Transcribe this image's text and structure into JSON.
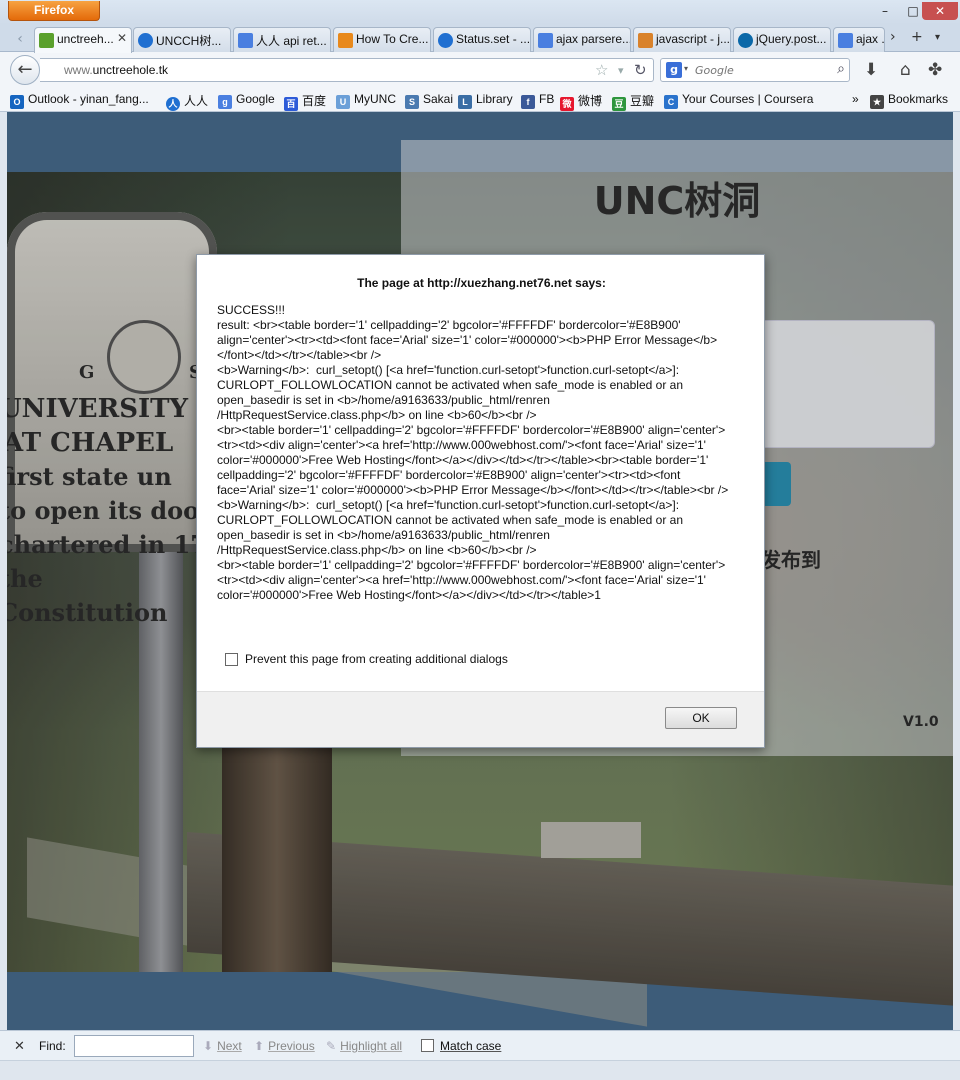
{
  "browser": {
    "app_button": "Firefox",
    "window_controls": {
      "minimize": "–",
      "maximize": "□",
      "close": "✕"
    },
    "tabs": [
      {
        "label": "unctreeh...",
        "active": true,
        "close": "✕"
      },
      {
        "label": "UNCCH树..."
      },
      {
        "label": "人人 api ret..."
      },
      {
        "label": "How To Cre..."
      },
      {
        "label": "Status.set - ..."
      },
      {
        "label": "ajax parsere..."
      },
      {
        "label": "javascript - j..."
      },
      {
        "label": "jQuery.post..."
      },
      {
        "label": "ajax ..."
      }
    ],
    "url_prefix": "www.",
    "url_domain": "unctreehole.tk",
    "search_placeholder": "Google",
    "bookmarks": [
      {
        "label": "Outlook - yinan_fang...",
        "icon_color": "#1565c0",
        "icon_glyph": "O"
      },
      {
        "label": "人人",
        "icon_color": "#1f6fd1",
        "icon_glyph": "人"
      },
      {
        "label": "Google",
        "icon_color": "#4a7fe0",
        "icon_glyph": "g"
      },
      {
        "label": "百度",
        "icon_color": "#2d5bd8",
        "icon_glyph": "百"
      },
      {
        "label": "MyUNC",
        "icon_color": "#6ca0d8",
        "icon_glyph": "U"
      },
      {
        "label": "Sakai",
        "icon_color": "#4a7ab0",
        "icon_glyph": "S"
      },
      {
        "label": "Library",
        "icon_color": "#3b6ea5",
        "icon_glyph": "L"
      },
      {
        "label": "FB",
        "icon_color": "#3b5998",
        "icon_glyph": "f"
      },
      {
        "label": "微博",
        "icon_color": "#e6162d",
        "icon_glyph": "微"
      },
      {
        "label": "豆瓣",
        "icon_color": "#2e963d",
        "icon_glyph": "豆"
      },
      {
        "label": "Your Courses | Coursera",
        "icon_color": "#2a73cc",
        "icon_glyph": "C"
      }
    ],
    "bookmarks_overflow": "»",
    "bookmarks_menu": "Bookmarks"
  },
  "page": {
    "title": "UNC树洞",
    "note": "会帮你发布到",
    "version": "V1.0",
    "sign_lines": [
      "UNIVERSITY",
      "AT CHAPEL",
      "first state un",
      "to open its doo",
      "chartered in 17",
      "the Constitution"
    ],
    "sign_letter": "G",
    "sign_letter_2": "S"
  },
  "dialog": {
    "title": "The page at http://xuezhang.net76.net says:",
    "message": "SUCCESS!!!\nresult: <br><table border='1' cellpadding='2' bgcolor='#FFFFDF' bordercolor='#E8B900'\nalign='center'><tr><td><font face='Arial' size='1' color='#000000'><b>PHP Error Message</b>\n</font></td></tr></table><br />\n<b>Warning</b>:  curl_setopt() [<a href='function.curl-setopt'>function.curl-setopt</a>]:\nCURLOPT_FOLLOWLOCATION cannot be activated when safe_mode is enabled or an\nopen_basedir is set in <b>/home/a9163633/public_html/renren\n/HttpRequestService.class.php</b> on line <b>60</b><br />\n<br><table border='1' cellpadding='2' bgcolor='#FFFFDF' bordercolor='#E8B900' align='center'>\n<tr><td><div align='center'><a href='http://www.000webhost.com/'><font face='Arial' size='1'\ncolor='#000000'>Free Web Hosting</font></a></div></td></tr></table><br><table border='1'\ncellpadding='2' bgcolor='#FFFFDF' bordercolor='#E8B900' align='center'><tr><td><font\nface='Arial' size='1' color='#000000'><b>PHP Error Message</b></font></td></tr></table><br />\n<b>Warning</b>:  curl_setopt() [<a href='function.curl-setopt'>function.curl-setopt</a>]:\nCURLOPT_FOLLOWLOCATION cannot be activated when safe_mode is enabled or an\nopen_basedir is set in <b>/home/a9163633/public_html/renren\n/HttpRequestService.class.php</b> on line <b>60</b><br />\n<br><table border='1' cellpadding='2' bgcolor='#FFFFDF' bordercolor='#E8B900' align='center'>\n<tr><td><div align='center'><a href='http://www.000webhost.com/'><font face='Arial' size='1'\ncolor='#000000'>Free Web Hosting</font></a></div></td></tr></table>1",
    "checkbox_label": "Prevent this page from creating additional dialogs",
    "ok_label": "OK"
  },
  "findbar": {
    "close": "✕",
    "label": "Find:",
    "value": "",
    "next": "Next",
    "previous": "Previous",
    "highlight": "Highlight all",
    "match_case": "Match case"
  }
}
